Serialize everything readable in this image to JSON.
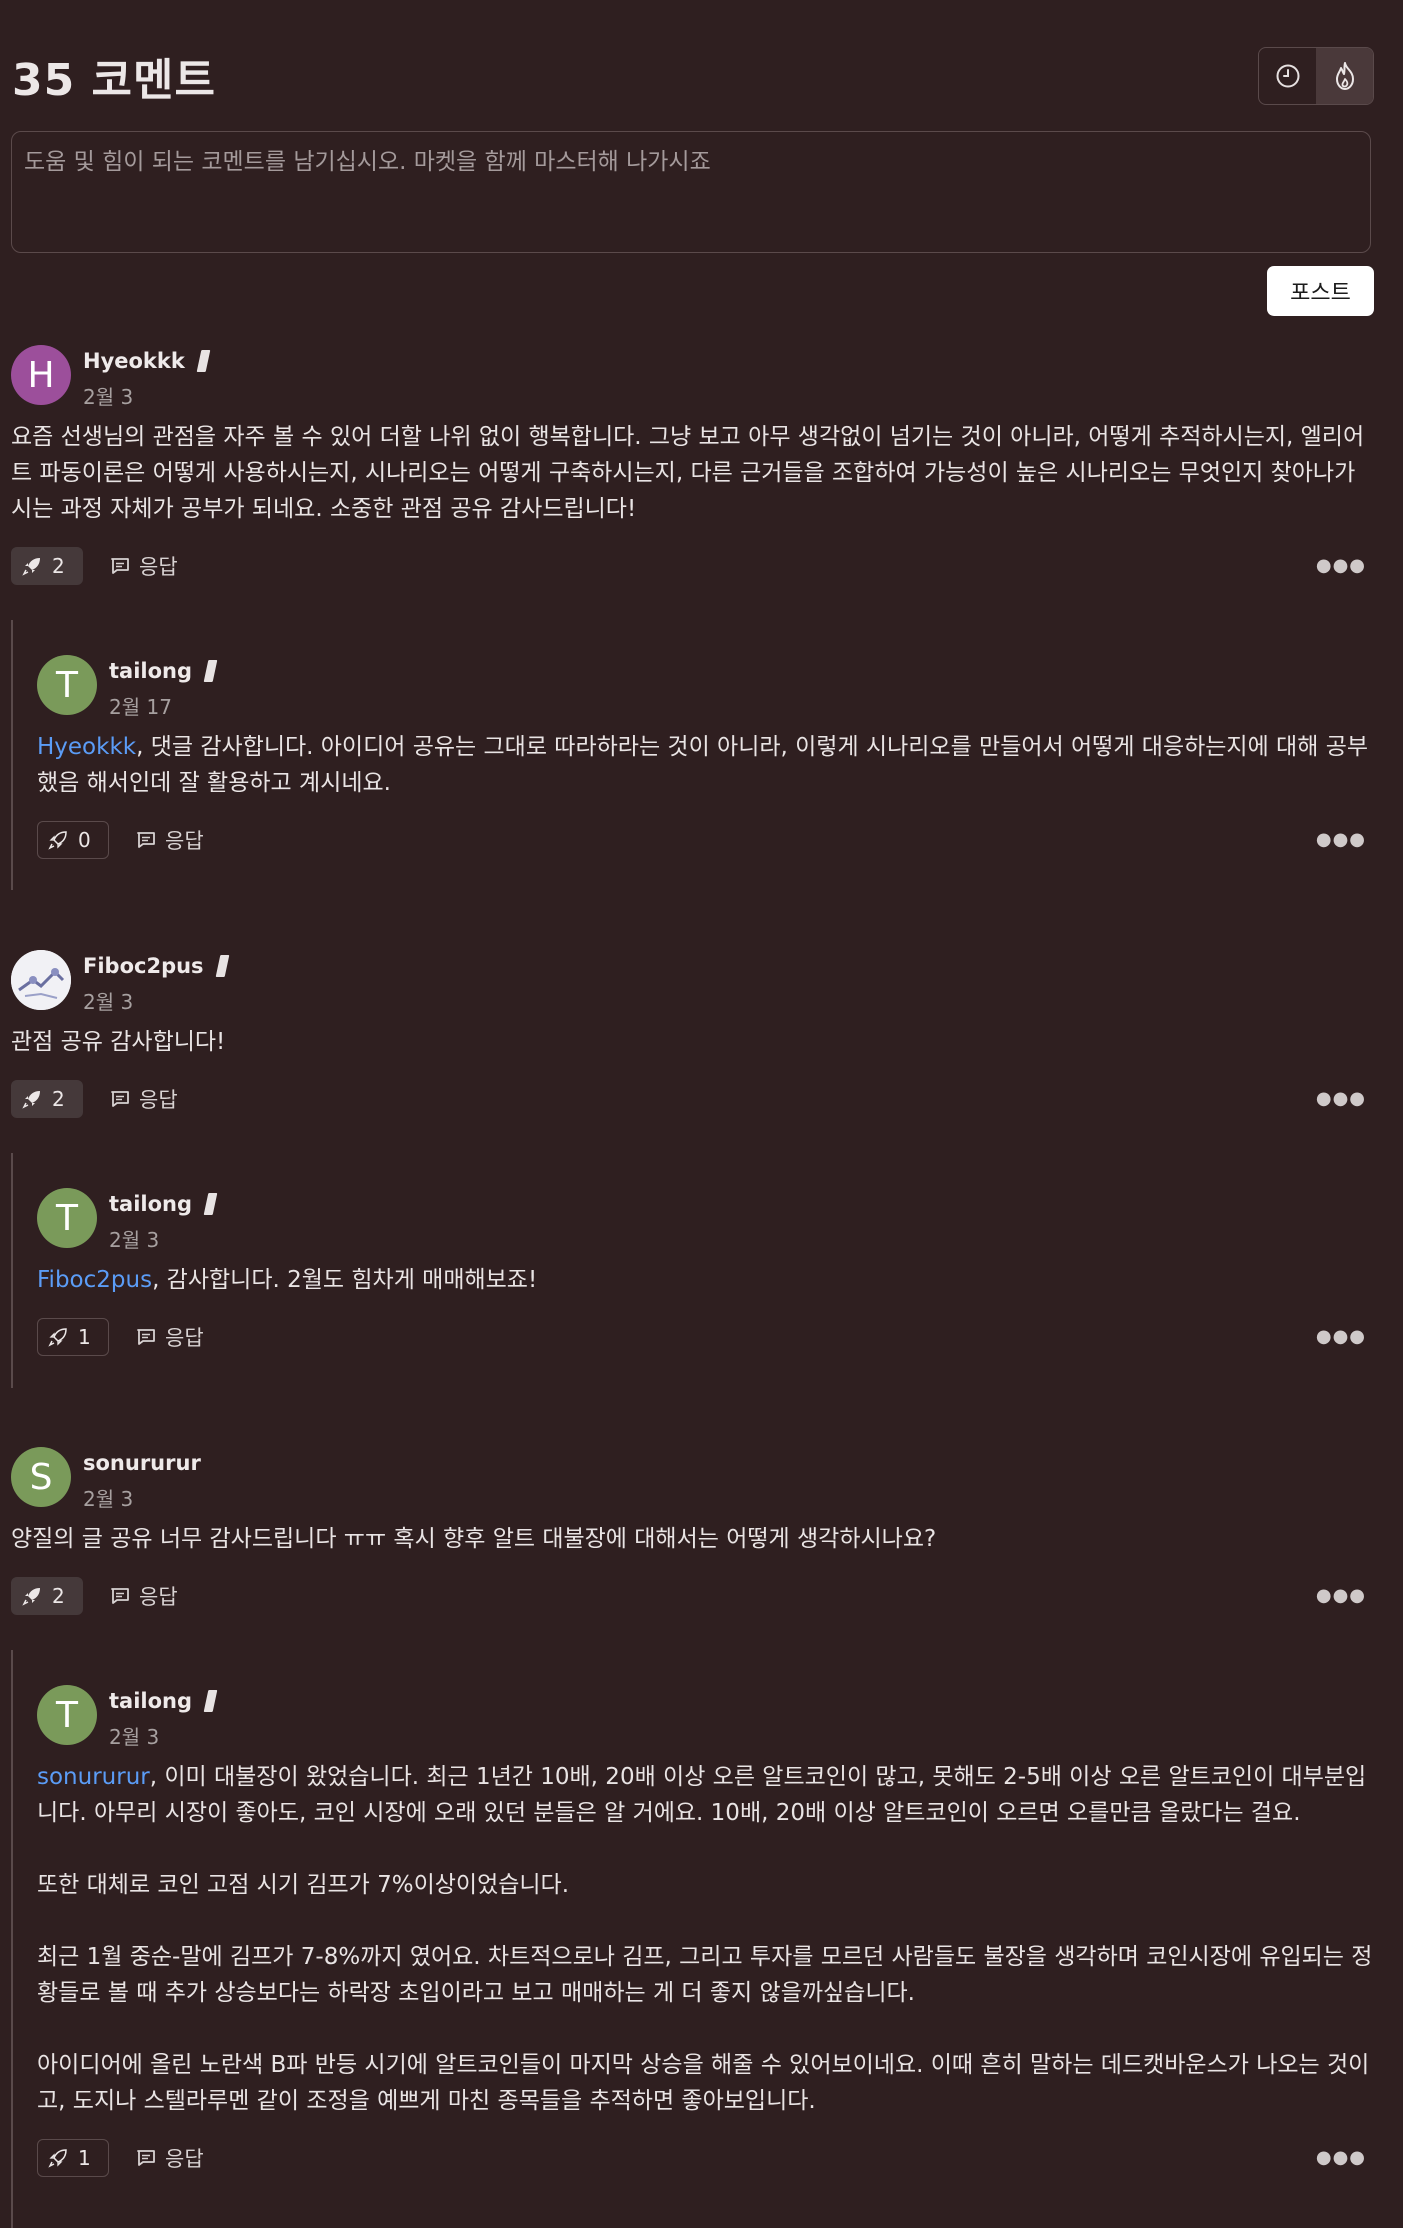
{
  "header": {
    "title": "35 코멘트",
    "sort_recent_icon": "clock-icon",
    "sort_popular_icon": "flame-icon"
  },
  "composer": {
    "placeholder": "도움 및 힘이 되는 코멘트를 남기십시오. 마켓을 함께 마스터해 나가시죠",
    "post_label": "포스트"
  },
  "labels": {
    "reply": "응답"
  },
  "colors": {
    "background": "#2f1f20",
    "mention": "#5b9cf6",
    "avatar_h": "#9c4f9b",
    "avatar_t": "#7a9a5a",
    "avatar_s": "#7a9a5a"
  },
  "comments": [
    {
      "author": "Hyeokkk",
      "avatar_letter": "H",
      "date": "2월 3",
      "body": "요즘 선생님의 관점을 자주 볼 수 있어 더할 나위 없이 행복합니다. 그냥 보고 아무 생각없이 넘기는 것이 아니라, 어떻게 추적하시는지, 엘리어트 파동이론은 어떻게 사용하시는지, 시나리오는 어떻게 구축하시는지, 다른 근거들을 조합하여 가능성이 높은 시나리오는 무엇인지 찾아나가시는 과정 자체가 공부가 되네요. 소중한 관점 공유 감사드립니다!",
      "boosts": "2",
      "reply": {
        "author": "tailong",
        "avatar_letter": "T",
        "date": "2월 17",
        "mention": "Hyeokkk",
        "body": ", 댓글 감사합니다. 아이디어 공유는 그대로 따라하라는 것이 아니라, 이렇게 시나리오를 만들어서 어떻게 대응하는지에 대해 공부했음 해서인데 잘 활용하고 계시네요.",
        "boosts": "0"
      }
    },
    {
      "author": "Fiboc2pus",
      "avatar_letter": "",
      "date": "2월 3",
      "body": "관점 공유 감사합니다!",
      "boosts": "2",
      "reply": {
        "author": "tailong",
        "avatar_letter": "T",
        "date": "2월 3",
        "mention": "Fiboc2pus",
        "body": ", 감사합니다. 2월도 힘차게 매매해보죠!",
        "boosts": "1"
      }
    },
    {
      "author": "sonururur",
      "avatar_letter": "S",
      "date": "2월 3",
      "body": "양질의 글 공유 너무 감사드립니다 ㅠㅠ 혹시 향후 알트 대불장에 대해서는 어떻게 생각하시나요?",
      "boosts": "2",
      "reply": {
        "author": "tailong",
        "avatar_letter": "T",
        "date": "2월 3",
        "mention": "sonururur",
        "body": ", 이미 대불장이 왔었습니다. 최근 1년간 10배, 20배 이상 오른 알트코인이 많고, 못해도 2-5배 이상 오른 알트코인이 대부분입니다. 아무리 시장이 좋아도, 코인 시장에 오래 있던 분들은 알 거에요. 10배, 20배 이상 알트코인이 오르면 오를만큼 올랐다는 걸요.\n\n또한 대체로 코인 고점 시기 김프가 7%이상이었습니다.\n\n최근 1월 중순-말에 김프가 7-8%까지 였어요. 차트적으로나 김프, 그리고 투자를 모르던 사람들도 불장을 생각하며 코인시장에 유입되는 정황들로 볼 때 추가 상승보다는 하락장 초입이라고 보고 매매하는 게 더 좋지 않을까싶습니다.\n\n아이디어에 올린 노란색 B파 반등 시기에 알트코인들이 마지막 상승을 해줄 수 있어보이네요. 이때 흔히 말하는 데드캣바운스가 나오는 것이고, 도지나 스텔라루멘 같이 조정을 예쁘게 마친 종목들을 추적하면 좋아보입니다.",
        "boosts": "1"
      }
    }
  ]
}
